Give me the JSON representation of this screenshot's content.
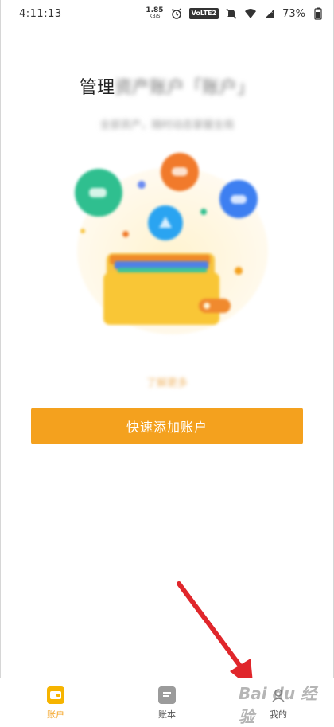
{
  "status_bar": {
    "time": "4:11:13",
    "net_speed": "1.85",
    "net_unit": "KB/S",
    "volte": "VoLTE2",
    "battery": "73%"
  },
  "hero": {
    "title_clear": "管理",
    "title_blurred": "资产账户「账户」",
    "subtitle": "全部资产，随时动态掌握全局",
    "learn_more": "了解更多"
  },
  "primary_button": {
    "label": "快速添加账户"
  },
  "bottom_nav": {
    "items": [
      {
        "label": "账户",
        "icon": "wallet-icon",
        "active": true
      },
      {
        "label": "账本",
        "icon": "ledger-icon",
        "active": false
      },
      {
        "label": "我的",
        "icon": "profile-icon",
        "active": false
      }
    ]
  },
  "watermark": {
    "text": "Bai du 经验"
  },
  "colors": {
    "accent": "#f4a11e",
    "nav_active_icon": "#f6b400",
    "annotation_arrow": "#e0262b"
  }
}
